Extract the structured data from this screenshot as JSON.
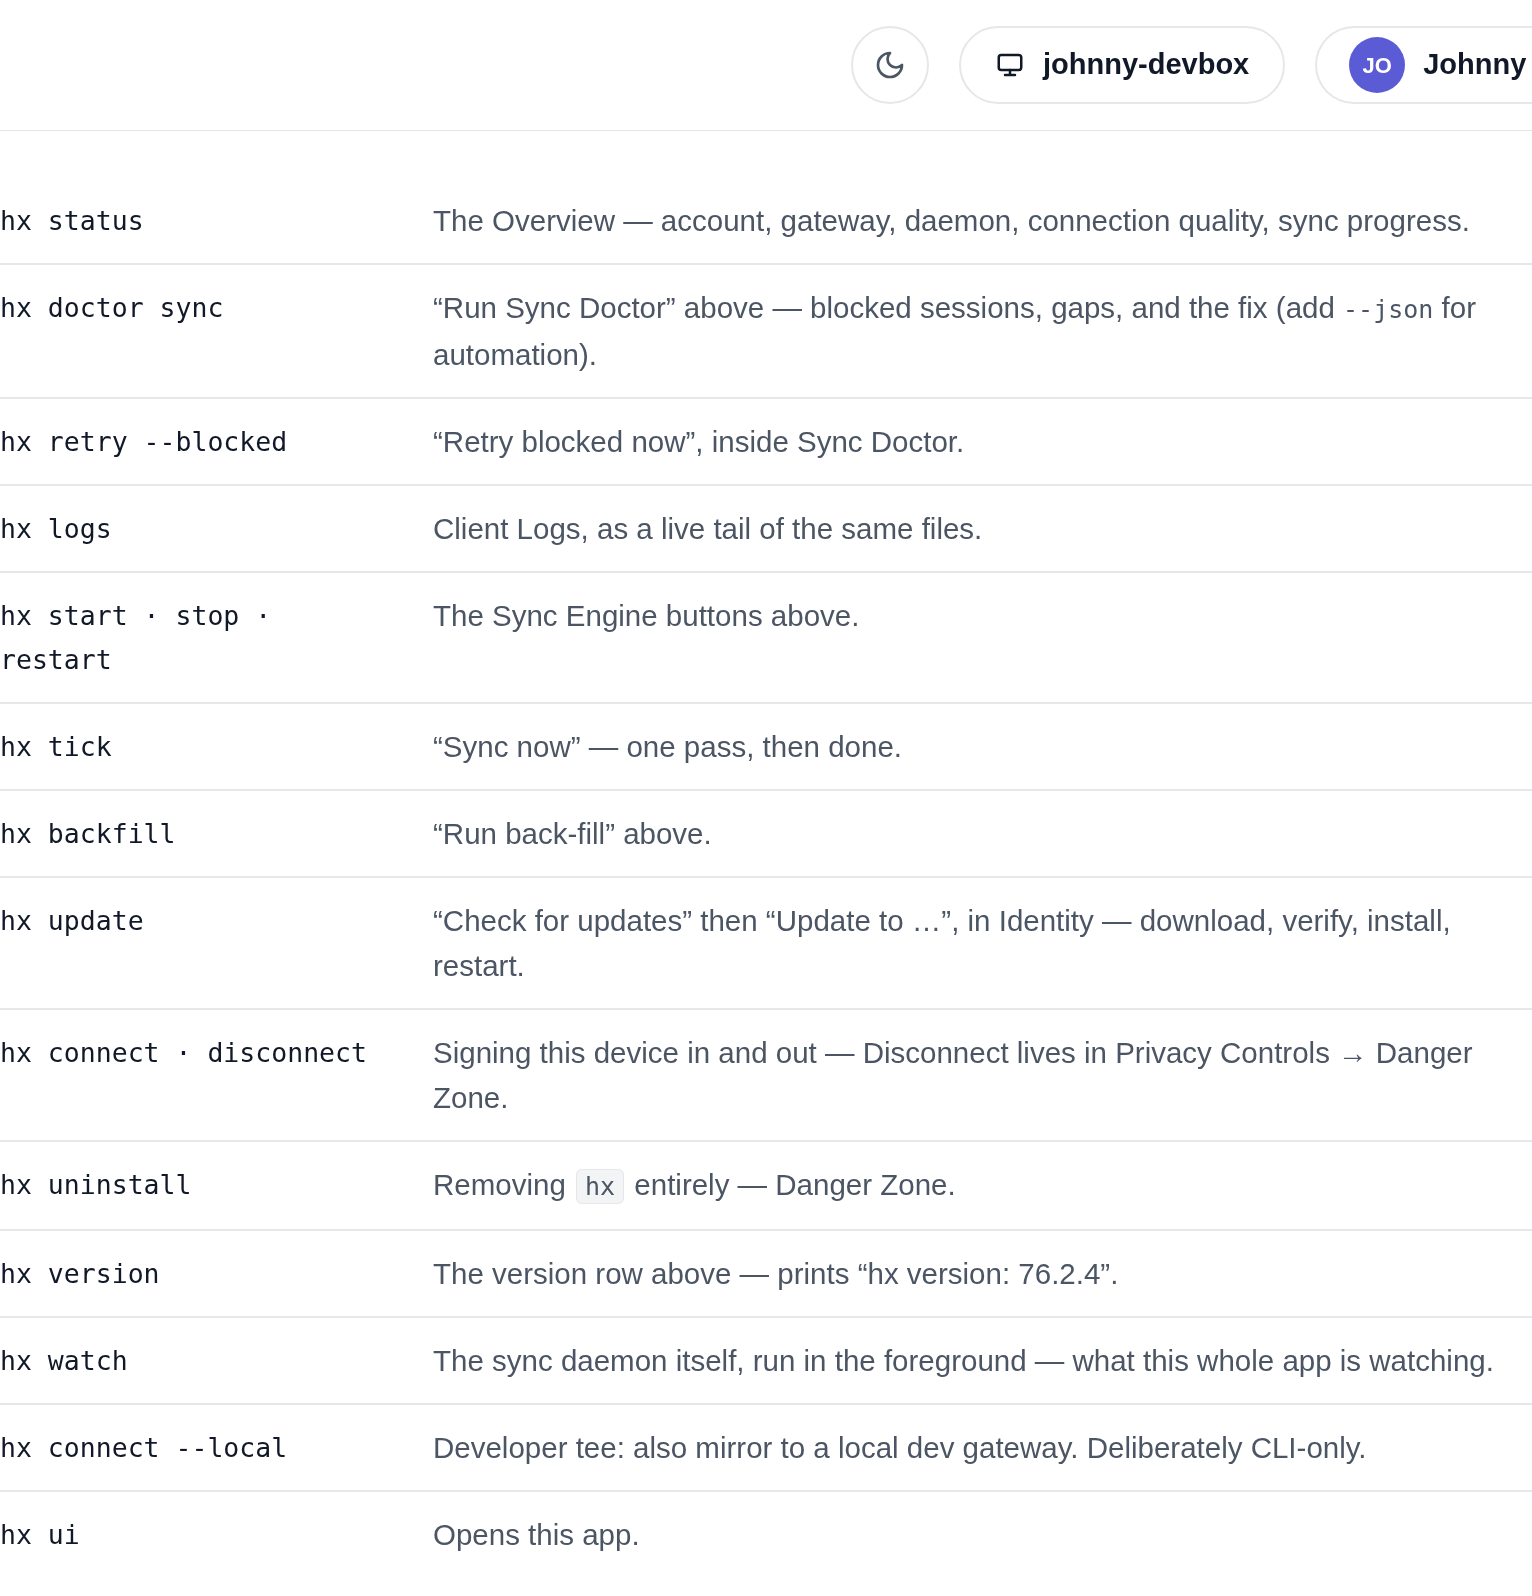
{
  "header": {
    "device": "johnny-devbox",
    "user": {
      "initials": "JO",
      "name": "Johnny"
    }
  },
  "commands": [
    {
      "command": "hx status",
      "description": [
        {
          "kind": "text",
          "text": "The Overview — account, gateway, daemon, connection quality, sync progress."
        }
      ]
    },
    {
      "command": "hx doctor sync",
      "description": [
        {
          "kind": "text",
          "text": "“Run Sync Doctor” above — blocked sessions, gaps, and the fix (add "
        },
        {
          "kind": "mono",
          "text": "--json"
        },
        {
          "kind": "text",
          "text": " for automation)."
        }
      ]
    },
    {
      "command": "hx retry --blocked",
      "description": [
        {
          "kind": "text",
          "text": "“Retry blocked now”, inside Sync Doctor."
        }
      ]
    },
    {
      "command": "hx logs",
      "description": [
        {
          "kind": "text",
          "text": "Client Logs, as a live tail of the same files."
        }
      ]
    },
    {
      "command": "hx start · stop · restart",
      "description": [
        {
          "kind": "text",
          "text": "The Sync Engine buttons above."
        }
      ]
    },
    {
      "command": "hx tick",
      "description": [
        {
          "kind": "text",
          "text": "“Sync now” — one pass, then done."
        }
      ]
    },
    {
      "command": "hx backfill",
      "description": [
        {
          "kind": "text",
          "text": "“Run back-fill” above."
        }
      ]
    },
    {
      "command": "hx update",
      "description": [
        {
          "kind": "text",
          "text": "“Check for updates” then “Update to …”, in Identity — download, verify, install, restart."
        }
      ]
    },
    {
      "command": "hx connect · disconnect",
      "description": [
        {
          "kind": "text",
          "text": "Signing this device in and out — Disconnect lives in Privacy Controls → Danger Zone."
        }
      ]
    },
    {
      "command": "hx uninstall",
      "description": [
        {
          "kind": "text",
          "text": "Removing "
        },
        {
          "kind": "code",
          "text": "hx"
        },
        {
          "kind": "text",
          "text": " entirely — Danger Zone."
        }
      ]
    },
    {
      "command": "hx version",
      "description": [
        {
          "kind": "text",
          "text": "The version row above — prints “hx version: 76.2.4”."
        }
      ]
    },
    {
      "command": "hx watch",
      "description": [
        {
          "kind": "text",
          "text": "The sync daemon itself, run in the foreground — what this whole app is watching."
        }
      ]
    },
    {
      "command": "hx connect --local",
      "description": [
        {
          "kind": "text",
          "text": "Developer tee: also mirror to a local dev gateway. Deliberately CLI-only."
        }
      ]
    },
    {
      "command": "hx ui",
      "description": [
        {
          "kind": "text",
          "text": "Opens this app."
        }
      ]
    }
  ]
}
